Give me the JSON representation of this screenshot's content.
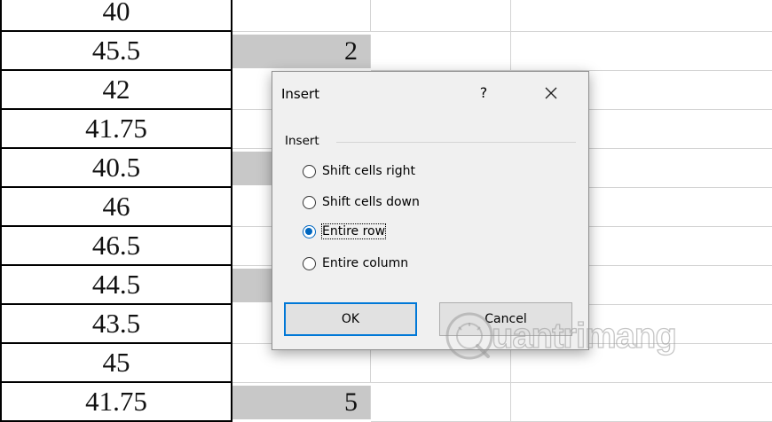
{
  "sheet": {
    "rows": [
      {
        "a": "40",
        "b": "",
        "shaded": false
      },
      {
        "a": "45.5",
        "b": "2",
        "shaded": true
      },
      {
        "a": "42",
        "b": "",
        "shaded": false
      },
      {
        "a": "41.75",
        "b": "",
        "shaded": false
      },
      {
        "a": "40.5",
        "b": "",
        "shaded": true
      },
      {
        "a": "46",
        "b": "",
        "shaded": false
      },
      {
        "a": "46.5",
        "b": "",
        "shaded": false
      },
      {
        "a": "44.5",
        "b": "",
        "shaded": true
      },
      {
        "a": "43.5",
        "b": "",
        "shaded": false
      },
      {
        "a": "45",
        "b": "",
        "shaded": false
      },
      {
        "a": "41.75",
        "b": "5",
        "shaded": true
      }
    ]
  },
  "dialog": {
    "title": "Insert",
    "help": "?",
    "close_icon": "close-icon",
    "group_label": "Insert",
    "options": [
      {
        "label": "Shift cells right",
        "checked": false
      },
      {
        "label": "Shift cells down",
        "checked": false
      },
      {
        "label": "Entire row",
        "checked": true
      },
      {
        "label": "Entire column",
        "checked": false
      }
    ],
    "ok_label": "OK",
    "cancel_label": "Cancel"
  },
  "watermark": {
    "text": "uantrimang",
    "icon": "quantrimang-logo-icon"
  },
  "colors": {
    "accent": "#0078d7",
    "radio_fill": "#0067c0",
    "shaded_cell": "#c8c8c8",
    "dialog_bg": "#f0f0f0"
  }
}
